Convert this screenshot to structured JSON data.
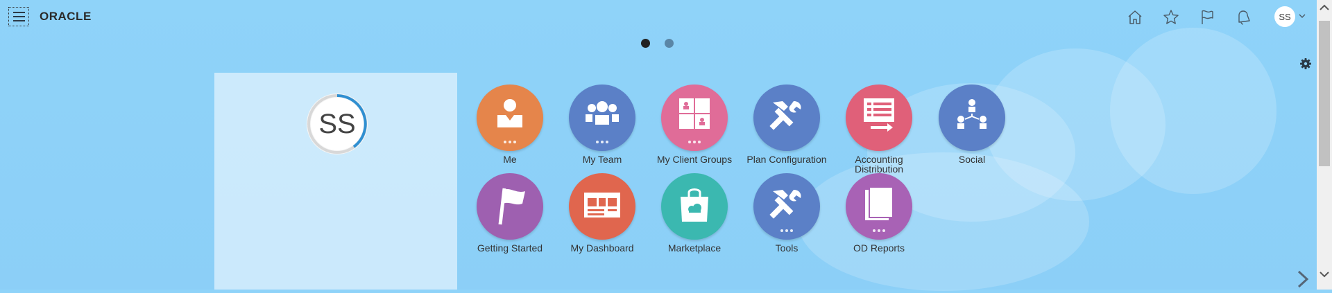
{
  "header": {
    "logo": "ORACLE",
    "icons": [
      "home-icon",
      "favorites-star-icon",
      "watchlist-flag-icon",
      "notifications-bell-icon"
    ],
    "avatar_initials": "SS"
  },
  "page_dots": {
    "count": 2,
    "active": 1
  },
  "profile": {
    "initials": "SS"
  },
  "apps": [
    {
      "label": "Me",
      "color": "#e5854b",
      "icon": "person-icon"
    },
    {
      "label": "My Team",
      "color": "#5b80c7",
      "icon": "team-icon"
    },
    {
      "label": "My Client Groups",
      "color": "#e06c98",
      "icon": "client-groups-icon"
    },
    {
      "label": "Plan Configuration",
      "color": "#5b80c7",
      "icon": "tools-icon"
    },
    {
      "label": "Accounting Distribution",
      "color": "#e06079",
      "icon": "accounting-icon"
    },
    {
      "label": "Social",
      "color": "#5b80c7",
      "icon": "social-icon"
    },
    {
      "label": "Getting Started",
      "color": "#9e60b0",
      "icon": "flag-icon"
    },
    {
      "label": "My Dashboard",
      "color": "#e0664e",
      "icon": "dashboard-icon"
    },
    {
      "label": "Marketplace",
      "color": "#3bb8b0",
      "icon": "shopping-bag-icon"
    },
    {
      "label": "Tools",
      "color": "#5b80c7",
      "icon": "tools-icon"
    },
    {
      "label": "OD Reports",
      "color": "#a862b5",
      "icon": "reports-icon"
    }
  ]
}
